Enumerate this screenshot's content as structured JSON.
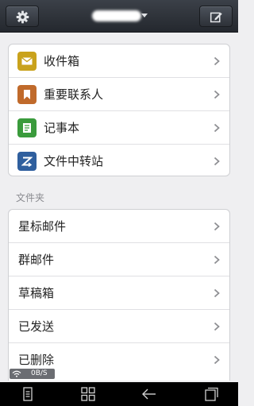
{
  "header": {
    "settings_icon": "gear-icon",
    "compose_icon": "compose-icon"
  },
  "main_list": [
    {
      "label": "收件箱",
      "icon": "inbox-icon",
      "color": "#c9a21c"
    },
    {
      "label": "重要联系人",
      "icon": "bookmark-icon",
      "color": "#c06a2b"
    },
    {
      "label": "记事本",
      "icon": "note-icon",
      "color": "#3a9b3c"
    },
    {
      "label": "文件中转站",
      "icon": "transfer-icon",
      "color": "#2f5f9e"
    }
  ],
  "folders_title": "文件夹",
  "folders": [
    {
      "label": "星标邮件"
    },
    {
      "label": "群邮件"
    },
    {
      "label": "草稿箱"
    },
    {
      "label": "已发送"
    },
    {
      "label": "已删除"
    }
  ],
  "status": {
    "net_speed": "0B/S"
  },
  "navbar": [
    "menu-icon",
    "apps-icon",
    "back-icon",
    "recent-apps-icon"
  ]
}
